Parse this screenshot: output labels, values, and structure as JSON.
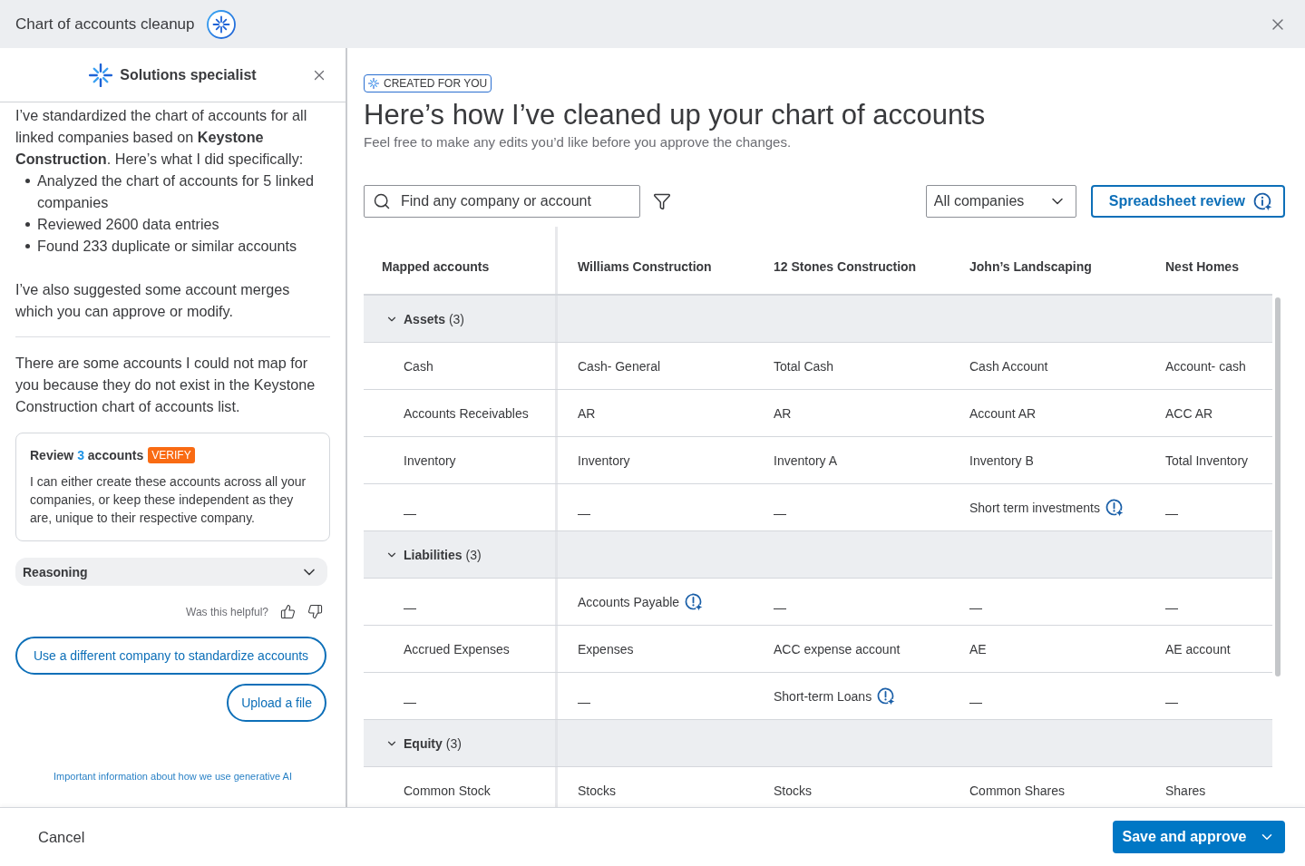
{
  "window": {
    "title": "Chart of accounts cleanup"
  },
  "assistant": {
    "title": "Solutions specialist",
    "intro": "I’ve standardized the chart of accounts for all linked companies based on **Keystone Construction**. Here’s what I did specifically:",
    "steps": [
      "Analyzed the chart of accounts for 5 linked companies",
      "Reviewed 2600 data entries",
      "Found 233 duplicate or similar accounts"
    ],
    "merge_note": "I’ve also suggested some account merges which you can approve or modify.",
    "unmapped_note": "There are some accounts I could not map for you because they do not exist in the Keystone Construction chart of accounts list.",
    "review_card": {
      "title_start": "Review",
      "count": "3",
      "title_end": "accounts",
      "badge": "VERIFY",
      "body": "I can either create these accounts across all your companies, or keep these independent as they are, unique to their respective company."
    },
    "reasoning": {
      "label": "Reasoning",
      "expanded": false
    },
    "feedback": {
      "prompt": "Was this helpful?"
    },
    "actions": [
      "Use a different company to standardize accounts",
      "Upload a file"
    ],
    "disclaimer_link": "Important information about how we use generative AI"
  },
  "main": {
    "badge": "CREATED FOR YOU",
    "heading": "Here’s how I’ve cleaned up your chart of accounts",
    "subheading": "Feel free to make any edits you’d like before you approve the changes.",
    "search": {
      "placeholder": "Find any company or account"
    },
    "company_filter": {
      "value": "All companies"
    },
    "spreadsheet_button": "Spreadsheet review",
    "table": {
      "columns": [
        "Mapped accounts",
        "Williams Construction",
        "12 Stones Construction",
        "John’s Landscaping",
        "Nest Homes"
      ],
      "groups": [
        {
          "label": "Assets",
          "count": "(3)",
          "expanded": true,
          "rows": [
            {
              "cells": [
                {
                  "kind": "account",
                  "text": "Cash",
                  "flagged": false
                },
                {
                  "kind": "account",
                  "text": "Cash- General",
                  "flagged": false
                },
                {
                  "kind": "account",
                  "text": "Total Cash",
                  "flagged": false
                },
                {
                  "kind": "account",
                  "text": "Cash Account",
                  "flagged": false
                },
                {
                  "kind": "account",
                  "text": "Account- cash",
                  "flagged": false
                }
              ]
            },
            {
              "cells": [
                {
                  "kind": "account",
                  "text": "Accounts Receivables",
                  "flagged": false
                },
                {
                  "kind": "account",
                  "text": "AR",
                  "flagged": false
                },
                {
                  "kind": "account",
                  "text": "AR",
                  "flagged": false
                },
                {
                  "kind": "account",
                  "text": "Account AR",
                  "flagged": false
                },
                {
                  "kind": "account",
                  "text": "ACC AR",
                  "flagged": false
                }
              ]
            },
            {
              "cells": [
                {
                  "kind": "account",
                  "text": "Inventory",
                  "flagged": false
                },
                {
                  "kind": "account",
                  "text": "Inventory",
                  "flagged": false
                },
                {
                  "kind": "account",
                  "text": "Inventory A",
                  "flagged": false
                },
                {
                  "kind": "account",
                  "text": "Inventory B",
                  "flagged": false
                },
                {
                  "kind": "account",
                  "text": "Total Inventory",
                  "flagged": false
                }
              ]
            },
            {
              "cells": [
                {
                  "kind": "empty",
                  "text": "—",
                  "flagged": false
                },
                {
                  "kind": "empty",
                  "text": "—",
                  "flagged": false
                },
                {
                  "kind": "empty",
                  "text": "—",
                  "flagged": false
                },
                {
                  "kind": "account",
                  "text": "Short term investments",
                  "flagged": true
                },
                {
                  "kind": "empty",
                  "text": "—",
                  "flagged": false
                }
              ]
            }
          ]
        },
        {
          "label": "Liabilities",
          "count": "(3)",
          "expanded": true,
          "rows": [
            {
              "cells": [
                {
                  "kind": "empty",
                  "text": "—",
                  "flagged": false
                },
                {
                  "kind": "account",
                  "text": "Accounts Payable",
                  "flagged": true
                },
                {
                  "kind": "empty",
                  "text": "—",
                  "flagged": false
                },
                {
                  "kind": "empty",
                  "text": "—",
                  "flagged": false
                },
                {
                  "kind": "empty",
                  "text": "—",
                  "flagged": false
                }
              ]
            },
            {
              "cells": [
                {
                  "kind": "account",
                  "text": "Accrued Expenses",
                  "flagged": false
                },
                {
                  "kind": "account",
                  "text": "Expenses",
                  "flagged": false
                },
                {
                  "kind": "account",
                  "text": "ACC expense account",
                  "flagged": false
                },
                {
                  "kind": "account",
                  "text": "AE",
                  "flagged": false
                },
                {
                  "kind": "account",
                  "text": "AE account",
                  "flagged": false
                }
              ]
            },
            {
              "cells": [
                {
                  "kind": "empty",
                  "text": "—",
                  "flagged": false
                },
                {
                  "kind": "empty",
                  "text": "—",
                  "flagged": false
                },
                {
                  "kind": "account",
                  "text": "Short-term Loans",
                  "flagged": true
                },
                {
                  "kind": "empty",
                  "text": "—",
                  "flagged": false
                },
                {
                  "kind": "empty",
                  "text": "—",
                  "flagged": false
                }
              ]
            }
          ]
        },
        {
          "label": "Equity",
          "count": "(3)",
          "expanded": true,
          "rows": [
            {
              "cells": [
                {
                  "kind": "account",
                  "text": "Common Stock",
                  "flagged": false
                },
                {
                  "kind": "account",
                  "text": "Stocks",
                  "flagged": false
                },
                {
                  "kind": "account",
                  "text": "Stocks",
                  "flagged": false
                },
                {
                  "kind": "account",
                  "text": "Common Shares",
                  "flagged": false
                },
                {
                  "kind": "account",
                  "text": "Shares",
                  "flagged": false
                }
              ]
            }
          ]
        }
      ]
    }
  },
  "footer": {
    "cancel": "Cancel",
    "primary": "Save and approve"
  }
}
